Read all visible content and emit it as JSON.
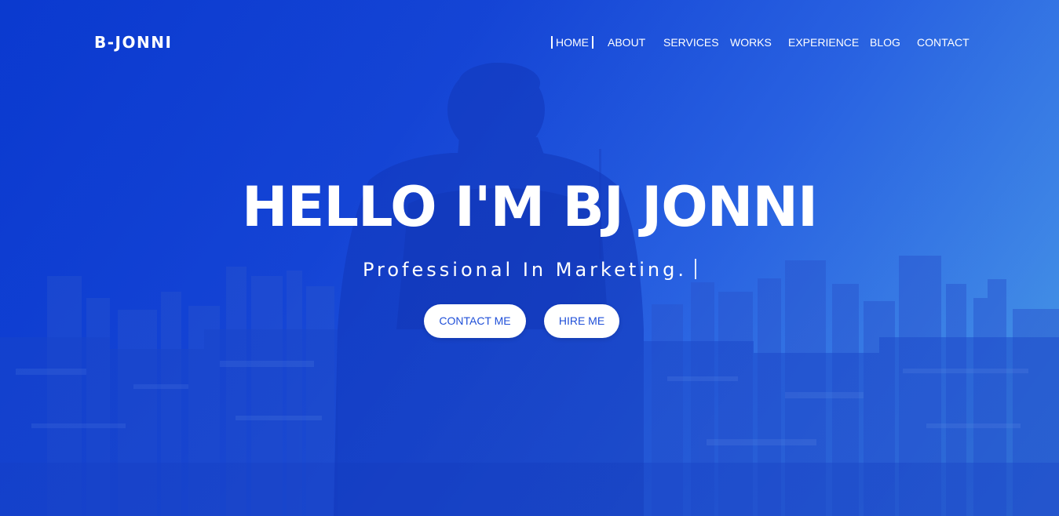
{
  "header": {
    "brand": "B-JONNI",
    "nav": [
      {
        "label": "HOME",
        "active": true
      },
      {
        "label": "ABOUT",
        "active": false
      },
      {
        "label": "SERVICES",
        "active": false
      },
      {
        "label": "WORKS",
        "active": false
      },
      {
        "label": "EXPERIENCE",
        "active": false
      },
      {
        "label": "BLOG",
        "active": false
      },
      {
        "label": "CONTACT",
        "active": false
      }
    ]
  },
  "hero": {
    "title": "HELLO I'M BJ JONNI",
    "subtitle": "Professional In Marketing.",
    "buttons": {
      "contact": "CONTACT ME",
      "hire": "HIRE ME"
    }
  },
  "colors": {
    "primary": "#1f4fd8",
    "gradient_start": "#0b3bd0",
    "gradient_end": "#4aa2e3",
    "text": "#ffffff"
  }
}
